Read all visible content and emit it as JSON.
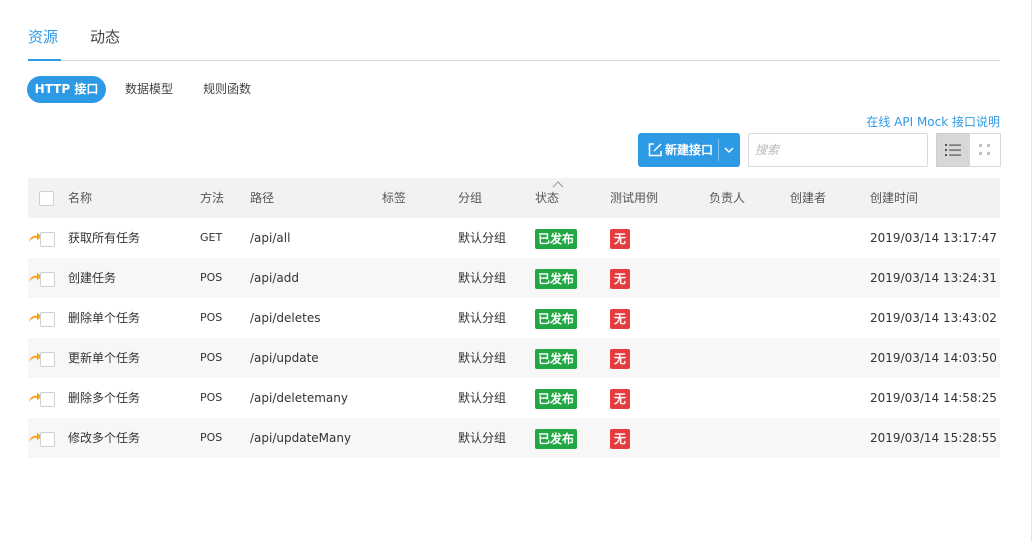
{
  "tabs": [
    {
      "label": "资源",
      "active": true
    },
    {
      "label": "动态",
      "active": false
    }
  ],
  "subtabs": [
    {
      "label": "HTTP 接口",
      "active": true
    },
    {
      "label": "数据模型",
      "active": false
    },
    {
      "label": "规则函数",
      "active": false
    }
  ],
  "help_link": "在线 API Mock 接口说明",
  "toolbar": {
    "new_button_label": "新建接口",
    "search_placeholder": "搜索",
    "view_mode": "list"
  },
  "table": {
    "columns": [
      "名称",
      "方法",
      "路径",
      "标签",
      "分组",
      "状态",
      "测试用例",
      "负责人",
      "创建者",
      "创建时间"
    ],
    "rows": [
      {
        "name": "获取所有任务",
        "method": "GET",
        "path": "/api/all",
        "tag": "",
        "group": "默认分组",
        "status": "已发布",
        "test": "无",
        "owner": "",
        "creator": "",
        "time": "2019/03/14 13:17:47"
      },
      {
        "name": "创建任务",
        "method": "POS",
        "path": "/api/add",
        "tag": "",
        "group": "默认分组",
        "status": "已发布",
        "test": "无",
        "owner": "",
        "creator": "",
        "time": "2019/03/14 13:24:31"
      },
      {
        "name": "删除单个任务",
        "method": "POS",
        "path": "/api/deletes",
        "tag": "",
        "group": "默认分组",
        "status": "已发布",
        "test": "无",
        "owner": "",
        "creator": "",
        "time": "2019/03/14 13:43:02"
      },
      {
        "name": "更新单个任务",
        "method": "POS",
        "path": "/api/update",
        "tag": "",
        "group": "默认分组",
        "status": "已发布",
        "test": "无",
        "owner": "",
        "creator": "",
        "time": "2019/03/14 14:03:50"
      },
      {
        "name": "删除多个任务",
        "method": "POS",
        "path": "/api/deletemany",
        "tag": "",
        "group": "默认分组",
        "status": "已发布",
        "test": "无",
        "owner": "",
        "creator": "",
        "time": "2019/03/14 14:58:25"
      },
      {
        "name": "修改多个任务",
        "method": "POS",
        "path": "/api/updateMany",
        "tag": "",
        "group": "默认分组",
        "status": "已发布",
        "test": "无",
        "owner": "",
        "creator": "",
        "time": "2019/03/14 15:28:55"
      }
    ]
  },
  "colors": {
    "accent": "#2d9ae6",
    "published": "#21a744",
    "no_test": "#e53d3d",
    "share_icon": "#f5a623"
  },
  "icons": {
    "new_button": "edit-icon",
    "dropdown": "chevron-down-icon",
    "list_view": "list-view-icon",
    "grid_view": "grid-view-icon",
    "row": "share-icon",
    "sort": "sort-up-icon"
  }
}
